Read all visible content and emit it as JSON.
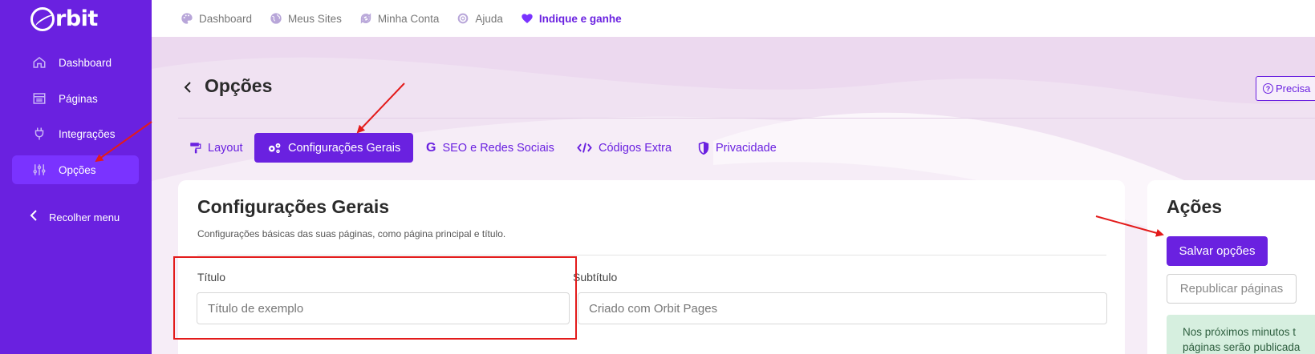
{
  "app": {
    "logo_text": "rbit"
  },
  "sidebar": {
    "items": [
      {
        "label": "Dashboard",
        "icon": "home-icon"
      },
      {
        "label": "Páginas",
        "icon": "pages-icon"
      },
      {
        "label": "Integrações",
        "icon": "plug-icon"
      },
      {
        "label": "Opções",
        "icon": "sliders-icon",
        "active": true
      }
    ],
    "collapse_label": "Recolher menu"
  },
  "topbar": {
    "items": [
      {
        "label": "Dashboard",
        "icon": "palette-icon"
      },
      {
        "label": "Meus Sites",
        "icon": "globe-icon"
      },
      {
        "label": "Minha Conta",
        "icon": "sync-icon"
      },
      {
        "label": "Ajuda",
        "icon": "lifebuoy-icon"
      },
      {
        "label": "Indique e ganhe",
        "icon": "heart-icon",
        "highlight": true
      }
    ]
  },
  "header": {
    "title": "Opções",
    "help_label": "Precisa"
  },
  "tabs": [
    {
      "label": "Layout",
      "icon": "paint-roller-icon"
    },
    {
      "label": "Configurações Gerais",
      "icon": "gears-icon",
      "active": true
    },
    {
      "label": "SEO e Redes Sociais",
      "icon": "google-icon"
    },
    {
      "label": "Códigos Extra",
      "icon": "code-icon"
    },
    {
      "label": "Privacidade",
      "icon": "shield-icon"
    }
  ],
  "settings": {
    "title": "Configurações Gerais",
    "description": "Configurações básicas das suas páginas, como página principal e título.",
    "title_field": {
      "label": "Título",
      "placeholder": "Título de exemplo"
    },
    "subtitle_field": {
      "label": "Subtítulo",
      "placeholder": "Criado com Orbit Pages"
    }
  },
  "actions": {
    "title": "Ações",
    "save_label": "Salvar opções",
    "republish_label": "Republicar páginas",
    "notice_line1": "Nos próximos minutos t",
    "notice_line2": "páginas serão publicada"
  },
  "colors": {
    "primary": "#6a21e0",
    "sidebar": "#6a21e0",
    "annotation": "#e31b1b",
    "notice_bg": "#d6efdf"
  }
}
